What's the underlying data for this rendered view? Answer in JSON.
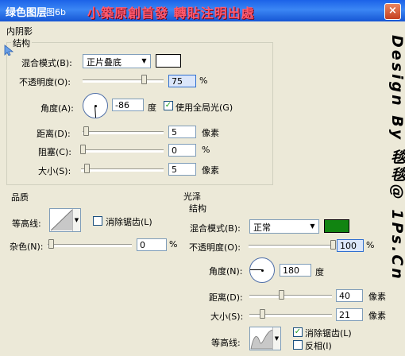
{
  "window": {
    "title": "绿色图层",
    "subtitle": "图6b",
    "watermark_top": "小築原創首發  轉貼注明出處",
    "watermark_side": "Design By 毯毯@ 1Ps.Cn",
    "close_label": "×"
  },
  "inner_shadow": {
    "section_title": "内阴影",
    "structure_title": "结构",
    "blend_mode_label": "混合模式(B):",
    "blend_mode_value": "正片叠底",
    "blend_color": "#ffffff",
    "opacity_label": "不透明度(O):",
    "opacity_value": "75",
    "opacity_unit": "%",
    "opacity_pct": 75,
    "angle_label": "角度(A):",
    "angle_value": "-86",
    "angle_unit": "度",
    "global_light_label": "使用全局光(G)",
    "global_light_checked": true,
    "distance_label": "距离(D):",
    "distance_value": "5",
    "distance_unit": "像素",
    "choke_label": "阻塞(C):",
    "choke_value": "0",
    "choke_unit": "%",
    "size_label": "大小(S):",
    "size_value": "5",
    "size_unit": "像素"
  },
  "quality": {
    "title": "品质",
    "contour_label": "等高线:",
    "antialias_label": "消除锯齿(L)",
    "antialias_checked": false,
    "noise_label": "杂色(N):",
    "noise_value": "0",
    "noise_unit": "%"
  },
  "gloss": {
    "title": "光泽",
    "structure_title": "结构",
    "blend_mode_label": "混合模式(B):",
    "blend_mode_value": "正常",
    "blend_color": "#118411",
    "opacity_label": "不透明度(O):",
    "opacity_value": "100",
    "opacity_unit": "%",
    "opacity_pct": 100,
    "angle_label": "角度(N):",
    "angle_value": "180",
    "angle_unit": "度",
    "distance_label": "距离(D):",
    "distance_value": "40",
    "distance_unit": "像素",
    "size_label": "大小(S):",
    "size_value": "21",
    "size_unit": "像素",
    "contour_label": "等高线:",
    "antialias_label": "消除锯齿(L)",
    "antialias_checked": true,
    "invert_label": "反相(I)",
    "invert_checked": false
  }
}
